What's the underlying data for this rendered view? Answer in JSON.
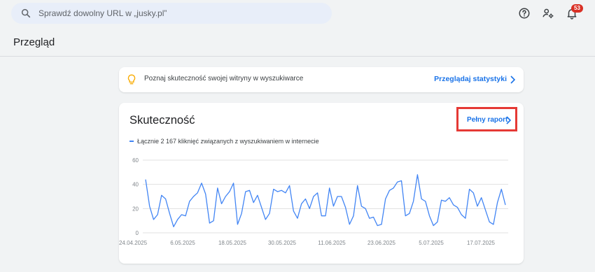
{
  "search": {
    "placeholder": "Sprawdź dowolny URL w „jusky.pl”"
  },
  "header": {
    "notifications_count": "53"
  },
  "page": {
    "title": "Przegląd"
  },
  "tip": {
    "text": "Poznaj skuteczność swojej witryny w wyszukiwarce",
    "link": "Przeglądaj statystyki"
  },
  "performance": {
    "title": "Skuteczność",
    "full_report": "Pełny raport",
    "legend": "Łącznie 2 167 kliknięć związanych z wyszukiwaniem w internecie"
  },
  "colors": {
    "series": "#4285f4",
    "link": "#1a73e8",
    "highlight": "#e53935",
    "badge": "#d93025"
  },
  "chart_data": {
    "type": "line",
    "title": "",
    "xlabel": "",
    "ylabel": "",
    "ylim": [
      0,
      60
    ],
    "yticks": [
      "0",
      "20",
      "40",
      "60"
    ],
    "xticks": [
      "24.04.2025",
      "6.05.2025",
      "18.05.2025",
      "30.05.2025",
      "11.06.2025",
      "23.06.2025",
      "5.07.2025",
      "17.07.2025"
    ],
    "x_start": "24.04.2025",
    "x_end": "27.07.2025",
    "grid": true,
    "series": [
      {
        "name": "Łącznie 2 167 kliknięć związanych z wyszukiwaniem w internecie",
        "values": [
          44,
          22,
          11,
          15,
          31,
          28,
          16,
          5,
          11,
          15,
          14,
          26,
          30,
          33,
          41,
          32,
          8,
          10,
          37,
          24,
          30,
          34,
          41,
          7,
          16,
          34,
          35,
          25,
          31,
          21,
          11,
          16,
          36,
          34,
          35,
          33,
          39,
          18,
          12,
          24,
          28,
          20,
          30,
          33,
          14,
          14,
          37,
          22,
          30,
          30,
          21,
          7,
          14,
          39,
          22,
          20,
          12,
          13,
          6,
          7,
          28,
          35,
          37,
          42,
          43,
          14,
          16,
          26,
          48,
          28,
          26,
          14,
          6,
          9,
          27,
          26,
          29,
          23,
          21,
          15,
          12,
          36,
          33,
          22,
          29,
          19,
          9,
          7,
          25,
          36,
          23
        ]
      }
    ]
  }
}
